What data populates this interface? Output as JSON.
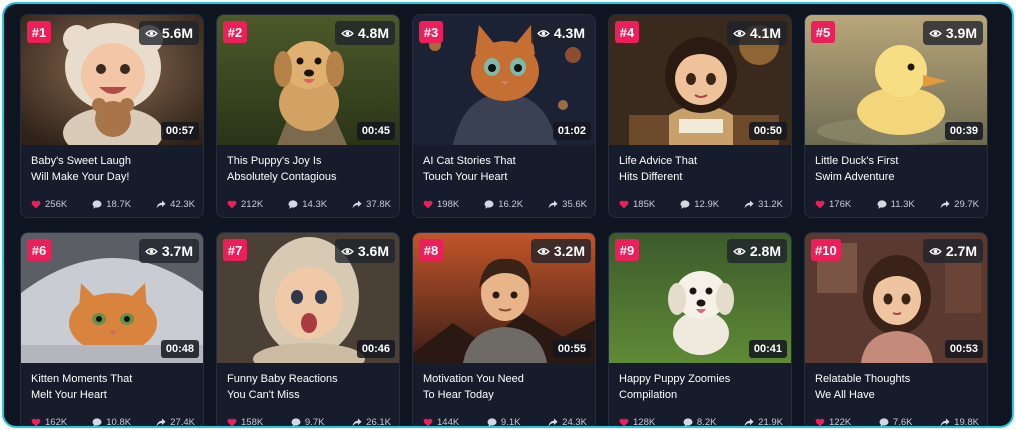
{
  "colors": {
    "accent": "#ec1f5b",
    "border": "#22c8e6",
    "background": "#0e1420",
    "card": "#161c2b"
  },
  "videos": [
    {
      "rank": "#1",
      "views": "5.6M",
      "duration": "00:57",
      "title_line1": "Baby's Sweet Laugh",
      "title_line2": "Will Make Your Day!",
      "likes": "256K",
      "comments": "18.7K",
      "shares": "42.3K",
      "thumbnail": "baby-with-teddy-bear"
    },
    {
      "rank": "#2",
      "views": "4.8M",
      "duration": "00:45",
      "title_line1": "This Puppy's Joy Is",
      "title_line2": "Absolutely Contagious",
      "likes": "212K",
      "comments": "14.3K",
      "shares": "37.8K",
      "thumbnail": "golden-puppy-running"
    },
    {
      "rank": "#3",
      "views": "4.3M",
      "duration": "01:02",
      "title_line1": "AI Cat Stories That",
      "title_line2": "Touch Your Heart",
      "likes": "198K",
      "comments": "16.2K",
      "shares": "35.6K",
      "thumbnail": "cat-in-hoodie-city"
    },
    {
      "rank": "#4",
      "views": "4.1M",
      "duration": "00:50",
      "title_line1": "Life Advice That",
      "title_line2": "Hits Different",
      "likes": "185K",
      "comments": "12.9K",
      "shares": "31.2K",
      "thumbnail": "girl-reading-book"
    },
    {
      "rank": "#5",
      "views": "3.9M",
      "duration": "00:39",
      "title_line1": "Little Duck's First",
      "title_line2": "Swim Adventure",
      "likes": "176K",
      "comments": "11.3K",
      "shares": "29.7K",
      "thumbnail": "duckling-in-water"
    },
    {
      "rank": "#6",
      "views": "3.7M",
      "duration": "00:48",
      "title_line1": "Kitten Moments That",
      "title_line2": "Melt Your Heart",
      "likes": "162K",
      "comments": "10.8K",
      "shares": "27.4K",
      "thumbnail": "kitten-under-blanket"
    },
    {
      "rank": "#7",
      "views": "3.6M",
      "duration": "00:46",
      "title_line1": "Funny Baby Reactions",
      "title_line2": "You Can't Miss",
      "likes": "158K",
      "comments": "9.7K",
      "shares": "26.1K",
      "thumbnail": "surprised-baby-hood"
    },
    {
      "rank": "#8",
      "views": "3.2M",
      "duration": "00:55",
      "title_line1": "Motivation You Need",
      "title_line2": "To Hear Today",
      "likes": "144K",
      "comments": "9.1K",
      "shares": "24.3K",
      "thumbnail": "boy-sunset"
    },
    {
      "rank": "#9",
      "views": "2.8M",
      "duration": "00:41",
      "title_line1": "Happy Puppy Zoomies",
      "title_line2": "Compilation",
      "likes": "128K",
      "comments": "8.2K",
      "shares": "21.9K",
      "thumbnail": "white-puppy-grass"
    },
    {
      "rank": "#10",
      "views": "2.7M",
      "duration": "00:53",
      "title_line1": "Relatable Thoughts",
      "title_line2": "We All Have",
      "likes": "122K",
      "comments": "7.6K",
      "shares": "19.8K",
      "thumbnail": "girl-in-room"
    }
  ]
}
